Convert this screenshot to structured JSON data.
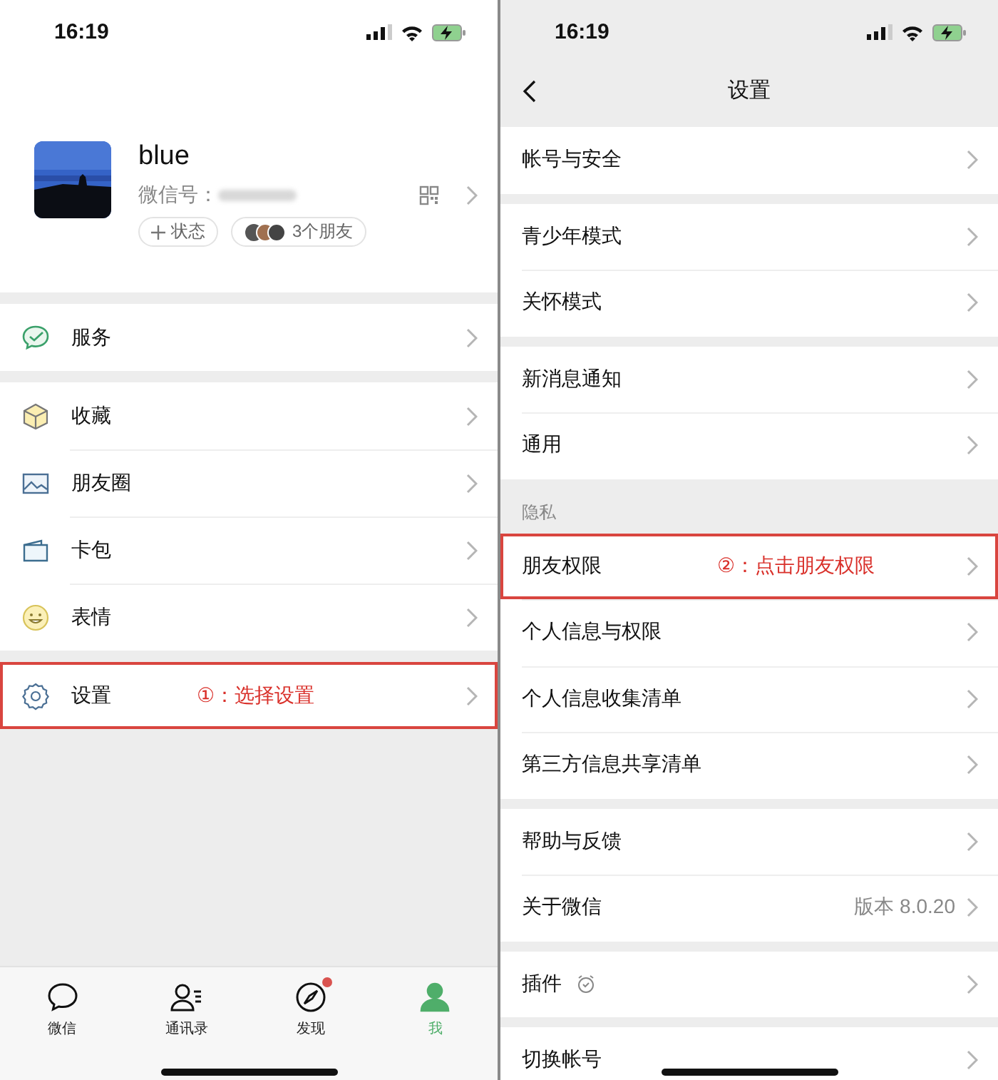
{
  "left_screen": {
    "status_bar": {
      "time": "16:19"
    },
    "profile": {
      "name": "blue",
      "wechat_id_label": "微信号：",
      "status_button": "状态",
      "friends": "3个朋友"
    },
    "menu_groups": [
      [
        {
          "kind": "service",
          "label": "服务",
          "highlighted": false
        }
      ],
      [
        {
          "kind": "favorites",
          "label": "收藏",
          "highlighted": false
        },
        {
          "kind": "moments",
          "label": "朋友圈",
          "highlighted": false
        },
        {
          "kind": "cards",
          "label": "卡包",
          "highlighted": false
        },
        {
          "kind": "stickers",
          "label": "表情",
          "highlighted": false
        }
      ],
      [
        {
          "kind": "settings",
          "label": "设置",
          "highlighted": true,
          "annotation": "①：选择设置"
        }
      ]
    ],
    "tabs": [
      {
        "kind": "chats",
        "label": "微信",
        "selected": false,
        "badge": false
      },
      {
        "kind": "contacts",
        "label": "通讯录",
        "selected": false,
        "badge": false
      },
      {
        "kind": "discover",
        "label": "发现",
        "selected": false,
        "badge": true
      },
      {
        "kind": "me",
        "label": "我",
        "selected": true,
        "badge": false
      }
    ]
  },
  "right_screen": {
    "status_bar": {
      "time": "16:19"
    },
    "title": "设置",
    "groups": [
      {
        "items": [
          {
            "label": "帐号与安全",
            "highlighted": false
          }
        ]
      },
      {
        "items": [
          {
            "label": "青少年模式",
            "highlighted": false
          },
          {
            "label": "关怀模式",
            "highlighted": false
          }
        ]
      },
      {
        "items": [
          {
            "label": "新消息通知",
            "highlighted": false
          },
          {
            "label": "通用",
            "highlighted": false
          }
        ]
      },
      {
        "header": "隐私",
        "items": [
          {
            "label": "朋友权限",
            "highlighted": true,
            "annotation": "②：点击朋友权限"
          },
          {
            "label": "个人信息与权限",
            "highlighted": false
          },
          {
            "label": "个人信息收集清单",
            "highlighted": false
          },
          {
            "label": "第三方信息共享清单",
            "highlighted": false
          }
        ]
      },
      {
        "items": [
          {
            "label": "帮助与反馈",
            "highlighted": false
          },
          {
            "label": "关于微信",
            "value": "版本 8.0.20",
            "highlighted": false
          }
        ]
      },
      {
        "items": [
          {
            "label": "插件",
            "kind": "plugin",
            "highlighted": false
          }
        ]
      },
      {
        "items": [
          {
            "label": "切换帐号",
            "highlighted": false
          }
        ]
      }
    ]
  }
}
